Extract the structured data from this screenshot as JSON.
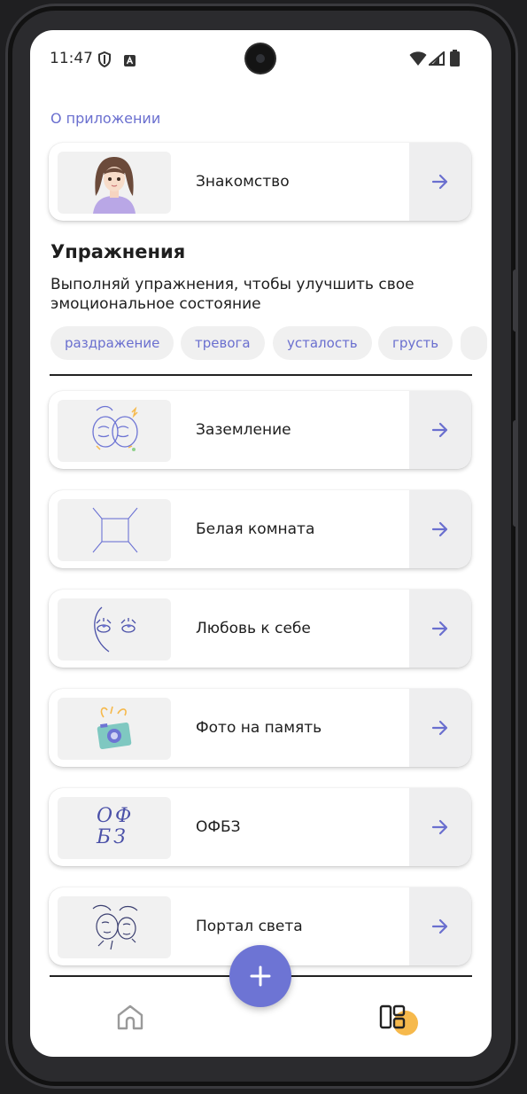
{
  "status_bar": {
    "time": "11:47"
  },
  "about": {
    "link": "О приложении",
    "card": {
      "title": "Знакомство"
    }
  },
  "exercises": {
    "title": "Упражнения",
    "description": "Выполняй упражнения, чтобы улучшить свое эмоциональное состояние",
    "chips": [
      "раздражение",
      "тревога",
      "усталость",
      "грусть"
    ],
    "items": [
      {
        "title": "Заземление"
      },
      {
        "title": "Белая комната"
      },
      {
        "title": "Любовь к себе"
      },
      {
        "title": "Фото на память"
      },
      {
        "title": "ОФБЗ",
        "thumb_text": "ОФ БЗ"
      },
      {
        "title": "Портал света"
      }
    ]
  },
  "colors": {
    "accent": "#6d74d4",
    "link": "#6a6fcf",
    "badge": "#f6b94c"
  },
  "icons": [
    "shield-icon",
    "keyboard-icon",
    "wifi-icon",
    "signal-icon",
    "battery-icon",
    "arrow-right-icon",
    "plus-icon",
    "home-icon",
    "dashboard-icon"
  ]
}
